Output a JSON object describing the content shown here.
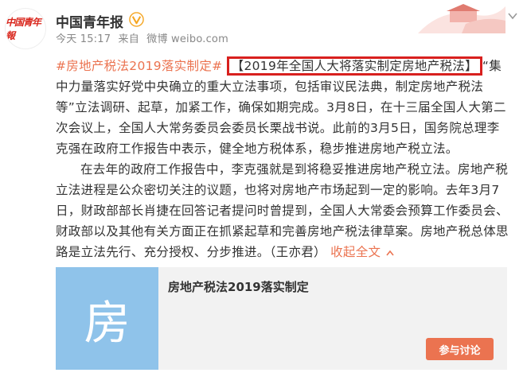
{
  "account": {
    "name": "中国青年报",
    "avatar_text": "中国青年報"
  },
  "post_meta": {
    "time": "今天 15:17",
    "source_prefix": "来自",
    "source": "微博 weibo.com"
  },
  "post": {
    "hashtag": "#房地产税法2019落实制定#",
    "headline": "【2019年全国人大将落实制定房地产税法】",
    "para1_rest": "“集中力量落实好党中央确立的重大立法事项，包括审议民法典，制定房地产税法等”立法调研、起草，加紧工作，确保如期完成。3月8日，在十三届全国人大第二次会议上，全国人大常务委员会委员长栗战书说。此前的3月5日，国务院总理李克强在政府工作报告中表示，健全地方税体系，稳步推进房地产税立法。",
    "para2": "在去年的政府工作报告中，李克强就是到将稳妥推进房地产税立法。房地产税立法进程是公众密切关注的议题，也将对房地产市场起到一定的影响。去年3月7日，财政部部长肖捷在回答记者提问时曾提到，全国人大常委会预算工作委员会、财政部以及其他有关方面正在抓紧起草和完善房地产税法律草案。房地产税总体思路是立法先行、充分授权、分步推进。（王亦君）",
    "collapse_link": "收起全文",
    "collapse_icon": "chevron-up-icon"
  },
  "card": {
    "thumb_char": "房",
    "title": "房地产税法2019落实制定",
    "button": "参与讨论"
  },
  "colors": {
    "link": "#eb7350",
    "highlight_border": "#d8201e",
    "card_thumb": "#8fc3ea",
    "verified": "#f5a623"
  }
}
